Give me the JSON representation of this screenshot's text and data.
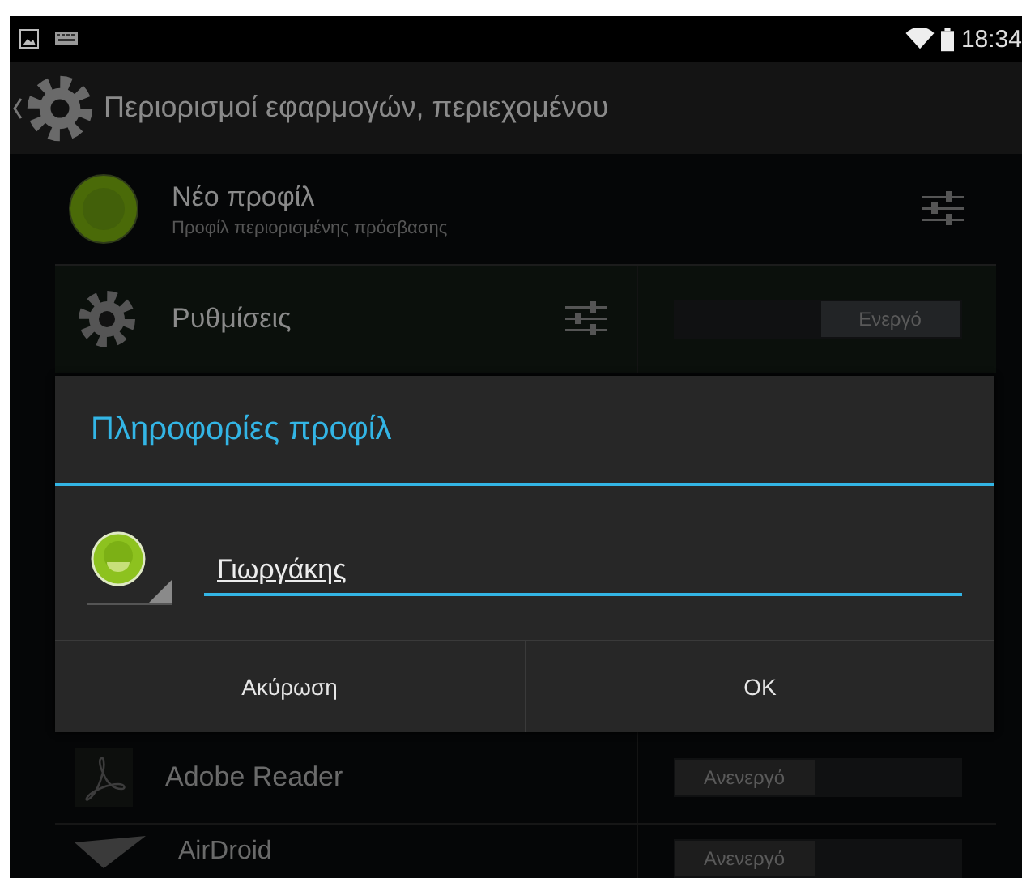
{
  "status_bar": {
    "time": "18:34"
  },
  "action_bar": {
    "title": "Περιορισμοί εφαρμογών, περιεχομένου"
  },
  "profile": {
    "name": "Νέο προφίλ",
    "subtitle": "Προφίλ περιορισμένης πρόσβασης"
  },
  "apps": [
    {
      "name": "Ρυθμίσεις",
      "kind": "settings",
      "toggle": "Ενεργό",
      "on": true,
      "has_settings": true
    },
    {
      "name": "Adobe Reader",
      "kind": "pdf",
      "toggle": "Ανενεργό",
      "on": false,
      "has_settings": false
    },
    {
      "name": "AirDroid",
      "kind": "plane",
      "toggle": "Ανενεργό",
      "on": false,
      "has_settings": false
    }
  ],
  "dialog": {
    "title": "Πληροφορίες προφίλ",
    "name_field": {
      "value": "Γιωργάκης"
    },
    "buttons": [
      "Ακύρωση",
      "OK"
    ]
  }
}
